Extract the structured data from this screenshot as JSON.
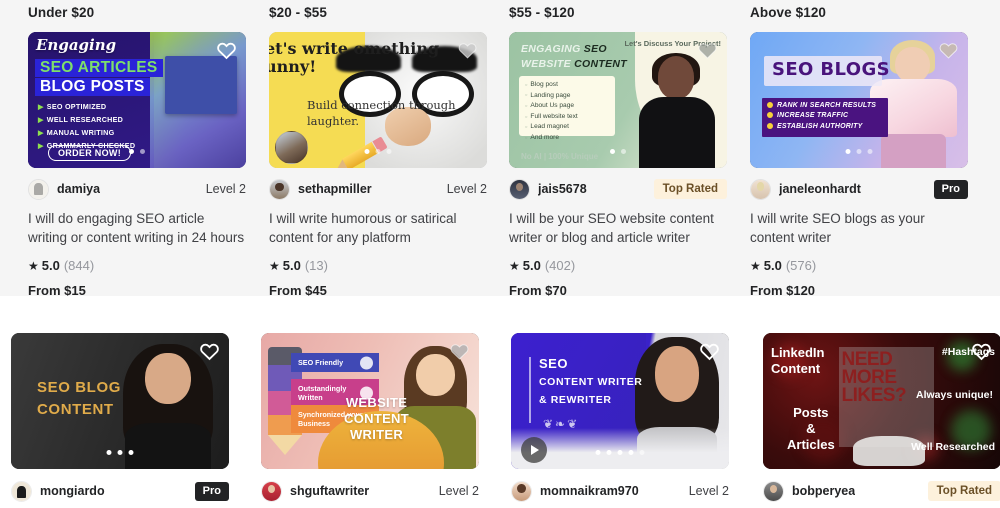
{
  "price_columns": [
    {
      "header": "Under $20"
    },
    {
      "header": "$20 - $55"
    },
    {
      "header": "$55 - $120"
    },
    {
      "header": "Above $120"
    }
  ],
  "top_gigs": [
    {
      "seller": "damiya",
      "level": "Level 2",
      "badge_type": "level",
      "title": "I will do engaging SEO article writing or content writing in 24 hours",
      "rating": "5.0",
      "reviews": "(844)",
      "price": "From $15",
      "dots_total": 2,
      "dots_active": 0,
      "favorite_icon": "heart-outline-icon",
      "thumbnail": {
        "headline_script": "Engaging",
        "headline_1": "SEO ARTICLES",
        "headline_2": "BLOG POSTS",
        "bullets": [
          "SEO OPTIMIZED",
          "WELL RESEARCHED",
          "MANUAL WRITING",
          "GRAMMARLY CHECKED"
        ],
        "cta": "ORDER NOW!"
      }
    },
    {
      "seller": "sethapmiller",
      "level": "Level 2",
      "badge_type": "level",
      "title": "I will write humorous or satirical content for any platform",
      "rating": "5.0",
      "reviews": "(13)",
      "price": "From $45",
      "dots_total": 3,
      "dots_active": 0,
      "favorite_icon": "heart-filled-icon",
      "thumbnail": {
        "headline": "et's write omething unny!",
        "subline": "Build connection through laughter."
      }
    },
    {
      "seller": "jais5678",
      "level": "Top Rated",
      "badge_type": "top-rated",
      "title": "I will be your SEO website content writer or blog and article writer",
      "rating": "5.0",
      "reviews": "(402)",
      "price": "From $70",
      "dots_total": 2,
      "dots_active": 0,
      "favorite_icon": "heart-filled-icon",
      "thumbnail": {
        "headline_1a": "ENGAGING ",
        "headline_1b": "SEO",
        "headline_2a": "WEBSITE ",
        "headline_2b": "CONTENT",
        "bullets": [
          "Blog post",
          "Landing page",
          "About Us page",
          "Full website text",
          "Lead magnet",
          "And more"
        ],
        "footer": "No AI | 100% Unique",
        "corner": "Let's Discuss Your Project!"
      }
    },
    {
      "seller": "janeleonhardt",
      "level": "Pro",
      "badge_type": "pro",
      "title": "I will write SEO blogs as your content writer",
      "rating": "5.0",
      "reviews": "(576)",
      "price": "From $120",
      "dots_total": 3,
      "dots_active": 0,
      "favorite_icon": "heart-filled-icon",
      "thumbnail": {
        "headline": "SEO BLOGS",
        "bullets": [
          "RANK IN SEARCH RESULTS",
          "INCREASE TRAFFIC",
          "ESTABLISH AUTHORITY"
        ]
      }
    }
  ],
  "bottom_gigs": [
    {
      "seller": "mongiardo",
      "level": "Pro",
      "badge_type": "pro",
      "dots_total": 3,
      "dots_active": 0,
      "has_video": false,
      "favorite_icon": "heart-outline-icon",
      "thumbnail": {
        "line_1": "SEO BLOG",
        "line_2": "CONTENT"
      }
    },
    {
      "seller": "shguftawriter",
      "level": "Level 2",
      "badge_type": "level",
      "dots_total": 0,
      "dots_active": -1,
      "has_video": false,
      "favorite_icon": "heart-filled-icon",
      "thumbnail": {
        "ribbon_1": "SEO Friendly",
        "ribbon_2": "Outstandingly Written",
        "ribbon_3": "Synchronized your Business",
        "line_1": "WEBSITE",
        "line_2": "CONTENT WRITER"
      }
    },
    {
      "seller": "momnaikram970",
      "level": "Level 2",
      "badge_type": "level",
      "dots_total": 5,
      "dots_active": 0,
      "has_video": true,
      "favorite_icon": "heart-outline-icon",
      "thumbnail": {
        "line_1": "SEO",
        "line_2": "CONTENT WRITER",
        "line_3": "& REWRITER"
      }
    },
    {
      "seller": "bobperyea",
      "level": "Top Rated",
      "badge_type": "top-rated",
      "dots_total": 0,
      "dots_active": -1,
      "has_video": false,
      "favorite_icon": "heart-outline-icon",
      "thumbnail": {
        "left_1": "LinkedIn",
        "left_2": "Content",
        "left_3": "Posts",
        "left_4": "&",
        "left_5": "Articles",
        "sign": "NEED MORE LIKES?",
        "right_1": "#Hashtags",
        "right_2": "Always unique!",
        "right_3": "Well Researched"
      }
    }
  ],
  "colors": {
    "section_bg": "#f5f5f5",
    "page_bg": "#ffffff",
    "text_primary": "#222325",
    "text_secondary": "#404145",
    "text_muted": "#95979d",
    "badge_pro_bg": "#222325",
    "badge_top_rated_bg": "#fdf1dc",
    "badge_top_rated_text": "#6b5027"
  }
}
